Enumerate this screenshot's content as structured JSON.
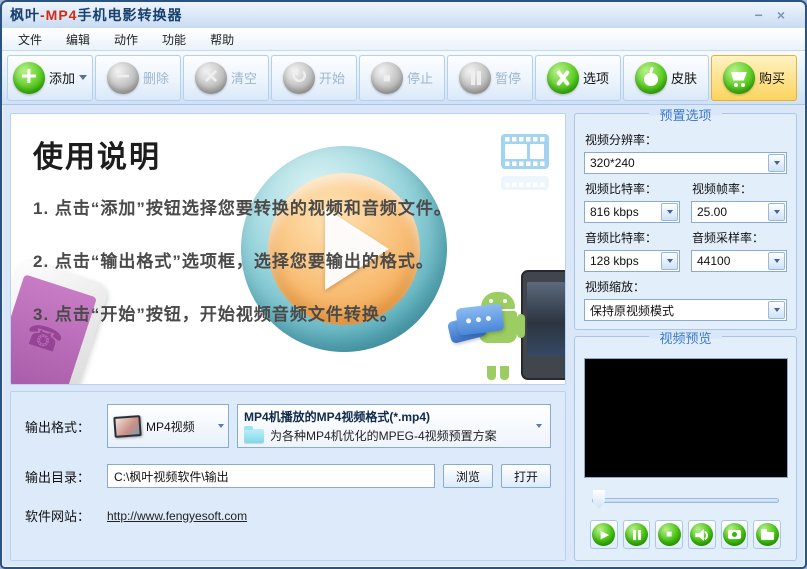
{
  "window": {
    "title_part1": "枫叶",
    "title_part2": "-MP4",
    "title_part3": "手机电影转换器",
    "minimize_glyph": "−",
    "close_glyph": "×"
  },
  "menu": {
    "items": [
      "文件",
      "编辑",
      "动作",
      "功能",
      "帮助"
    ]
  },
  "toolbar": {
    "buttons": [
      {
        "label": "添加",
        "icon": "plus-icon",
        "enabled": true,
        "has_dropdown": true
      },
      {
        "label": "删除",
        "icon": "minus-icon",
        "enabled": false
      },
      {
        "label": "清空",
        "icon": "clear-x-icon",
        "enabled": false
      },
      {
        "label": "开始",
        "icon": "start-refresh-icon",
        "enabled": false
      },
      {
        "label": "停止",
        "icon": "stop-icon",
        "enabled": false
      },
      {
        "label": "暂停",
        "icon": "pause-icon",
        "enabled": false
      },
      {
        "label": "选项",
        "icon": "tools-icon",
        "enabled": true
      },
      {
        "label": "皮肤",
        "icon": "apple-icon",
        "enabled": true
      },
      {
        "label": "购买",
        "icon": "cart-icon",
        "enabled": true,
        "highlighted": true
      }
    ]
  },
  "instructions": {
    "heading": "使用说明",
    "steps": [
      "1. 点击“添加”按钮选择您要转换的视频和音频文件。",
      "2. 点击“输出格式”选项框，选择您要输出的格式。",
      "3. 点击“开始”按钮，开始视频音频文件转换。"
    ]
  },
  "output": {
    "format_label": "输出格式：",
    "format_value": "MP4视频",
    "preset_title": "MP4机播放的MP4视频格式(*.mp4)",
    "preset_desc": "为各种MP4机优化的MPEG-4视频预置方案",
    "dir_label": "输出目录：",
    "dir_value": "C:\\枫叶视频软件\\输出",
    "browse_label": "浏览",
    "open_label": "打开",
    "site_label": "软件网站：",
    "site_url": "http://www.fengyesoft.com"
  },
  "preset": {
    "title": "预置选项",
    "resolution_label": "视频分辨率：",
    "resolution_value": "320*240",
    "video_bitrate_label": "视频比特率：",
    "video_bitrate_value": "816 kbps",
    "framerate_label": "视频帧率：",
    "framerate_value": "25.00",
    "audio_bitrate_label": "音频比特率：",
    "audio_bitrate_value": "128 kbps",
    "samplerate_label": "音频采样率：",
    "samplerate_value": "44100",
    "scale_label": "视频缩放：",
    "scale_value": "保持原视频模式"
  },
  "preview": {
    "title": "视频预览",
    "controls": [
      "play",
      "pause",
      "stop",
      "volume",
      "snapshot",
      "folder"
    ]
  },
  "colors": {
    "accent_green": "#45c20f",
    "buy_highlight": "#fcd45e",
    "title_navy": "#17406f",
    "title_red": "#d42a12",
    "header_blue": "#3c7ad0",
    "panel_bg": "#e3eefb",
    "window_border": "#2a5283"
  }
}
